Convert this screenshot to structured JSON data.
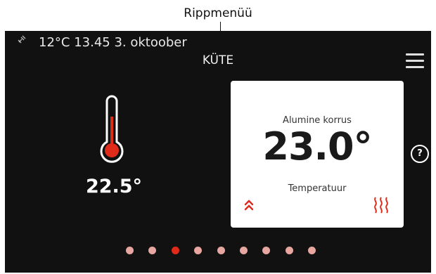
{
  "callout": {
    "label": "Rippmenüü"
  },
  "status_bar": {
    "text": "12°C 13.45 3. oktoober",
    "signal_icon": "satellite-icon"
  },
  "header": {
    "title": "KÜTE",
    "menu_icon": "hamburger-menu-icon"
  },
  "thermometer": {
    "value": "22.5°",
    "icon": "thermometer-icon"
  },
  "zone_card": {
    "zone": "Alumine korrus",
    "value": "23.0°",
    "label": "Temperatuur",
    "left_icon": "double-chevron-up-icon",
    "right_icon": "heat-waves-icon"
  },
  "help": {
    "label": "?"
  },
  "pagination": {
    "count": 9,
    "active_index": 2
  },
  "colors": {
    "accent": "#e02a1a",
    "dot_inactive": "#e8a6a0",
    "screen_bg": "#111111"
  }
}
